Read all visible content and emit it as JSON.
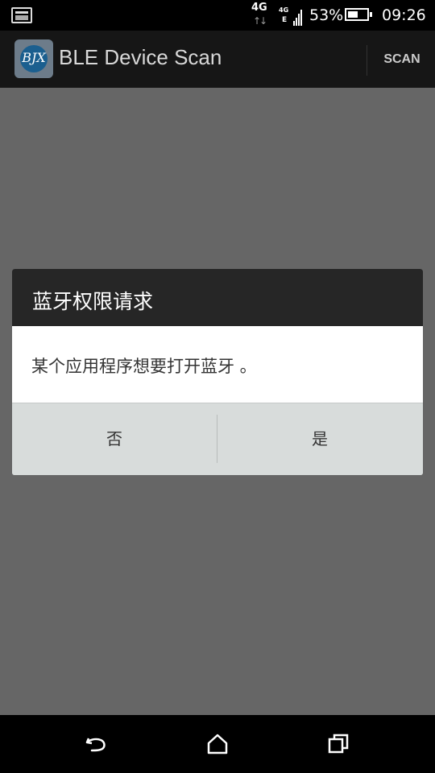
{
  "status_bar": {
    "network": "4G",
    "signal_top": "4G",
    "signal_bottom": "E",
    "battery_percent": "53%",
    "battery_level": 0.53,
    "time": "09:26"
  },
  "action_bar": {
    "app_icon_text": "BJX",
    "title": "BLE Device Scan",
    "scan_label": "SCAN"
  },
  "dialog": {
    "title": "蓝牙权限请求",
    "message": "某个应用程序想要打开蓝牙 。",
    "negative_label": "否",
    "positive_label": "是"
  },
  "nav_bar": {
    "icons": [
      "back-icon",
      "home-icon",
      "recents-icon"
    ]
  },
  "colors": {
    "scrim": "#666666",
    "dialog_title_bg": "#262626",
    "dialog_buttons_bg": "#d8dcdb",
    "app_icon_disc": "#1b5f8f"
  }
}
